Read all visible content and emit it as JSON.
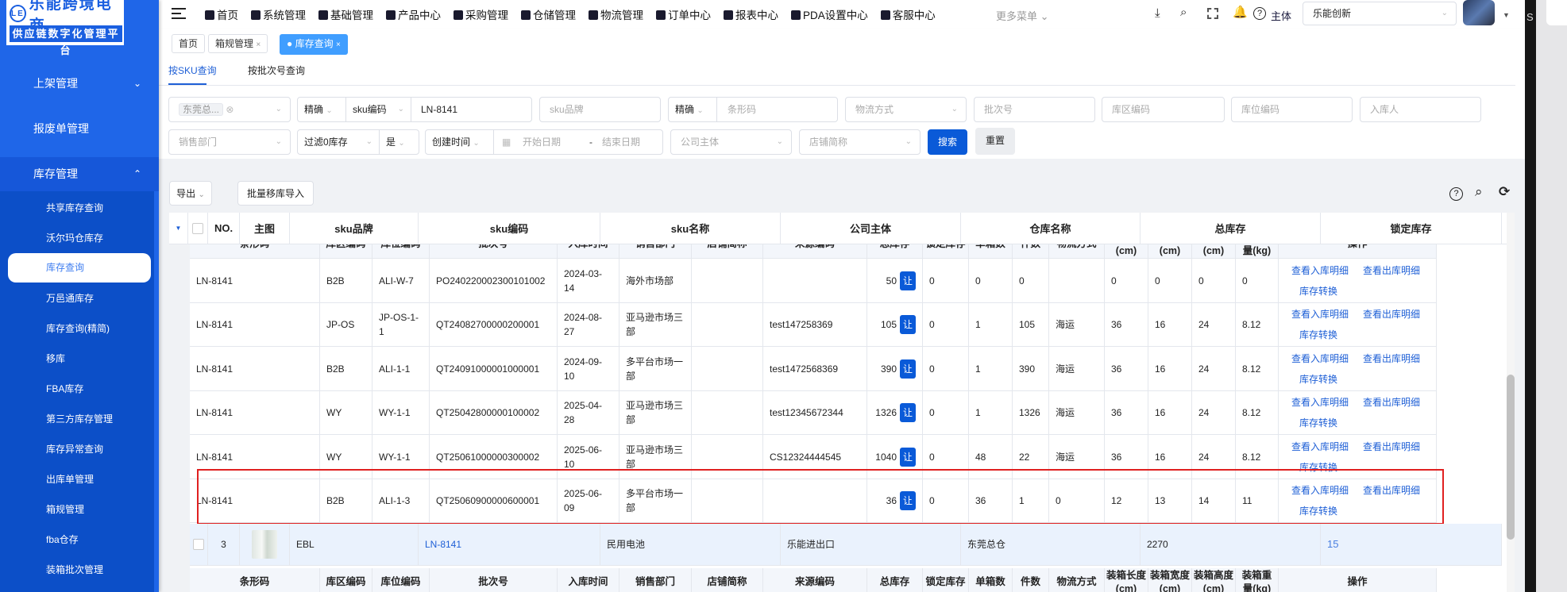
{
  "logo": {
    "title": "乐能跨境电商",
    "subtitle": "供应链数字化管理平台",
    "mark": "LE"
  },
  "sidebar": {
    "groups": [
      {
        "label": "上架管理",
        "chev": "⌄"
      },
      {
        "label": "报废单管理"
      },
      {
        "label": "库存管理",
        "chev": "⌃"
      }
    ],
    "sub_items": [
      "共享库存查询",
      "沃尔玛仓库存",
      "库存查询",
      "万邑通库存",
      "库存查询(精简)",
      "移库",
      "FBA库存",
      "第三方库存管理",
      "库存异常查询",
      "出库单管理",
      "箱规管理",
      "fba仓存",
      "装箱批次管理"
    ],
    "active_index": 2
  },
  "topnav": {
    "items": [
      "首页",
      "系统管理",
      "基础管理",
      "产品中心",
      "采购管理",
      "仓储管理",
      "物流管理",
      "订单中心",
      "报表中心",
      "PDA设置中心",
      "客服中心"
    ],
    "more": "更多菜单",
    "entity_label": "主体",
    "entity_value": "乐能创新"
  },
  "tabs": [
    {
      "label": "首页"
    },
    {
      "label": "箱规管理",
      "close": "×"
    },
    {
      "label": "库存查询",
      "close": "×"
    }
  ],
  "query_tabs": [
    "按SKU查询",
    "按批次号查询"
  ],
  "filters": {
    "warehouse_tag": "东莞总...",
    "match1": "精确",
    "field1": "sku编码",
    "value1": "LN-8141",
    "sku_brand": "sku品牌",
    "match2": "精确",
    "barcode": "条形码",
    "shipping": "物流方式",
    "batch": "批次号",
    "zone": "库区编码",
    "location": "库位编码",
    "inbound_user": "入库人",
    "dept": "销售部门",
    "filter_zero": "过滤0库存",
    "filter_zero_val": "是",
    "time_type": "创建时间",
    "start_date": "开始日期",
    "date_sep": "-",
    "end_date": "结束日期",
    "company": "公司主体",
    "shop": "店铺简称",
    "search": "搜索",
    "reset": "重置"
  },
  "toolbar": {
    "export": "导出",
    "batch_import": "批量移库导入"
  },
  "table": {
    "header": [
      "",
      "",
      "NO.",
      "主图",
      "sku品牌",
      "sku编码",
      "sku名称",
      "公司主体",
      "仓库名称",
      "总库存",
      "锁定库存"
    ],
    "sub_header": [
      "条形码",
      "库区编码",
      "库位编码",
      "批次号",
      "入库时间",
      "销售部门",
      "店铺简称",
      "来源编码",
      "总库存",
      "锁定库存",
      "单箱数",
      "件数",
      "物流方式",
      "装箱长度(cm)",
      "装箱宽度(cm)",
      "装箱高度(cm)",
      "装箱重量(kg)",
      "操作"
    ],
    "transfer_btn": "让",
    "actions": [
      "查看入库明细",
      "查看出库明细",
      "库存转换"
    ],
    "rows": [
      [
        "LN-8141",
        "B2B",
        "ALI-W-7",
        "PO240220002300101002",
        "2024-03-14",
        "海外市场部",
        "",
        "",
        "50",
        "0",
        "0",
        "0",
        "",
        "0",
        "0",
        "0",
        "0"
      ],
      [
        "LN-8141",
        "JP-OS",
        "JP-OS-1-1",
        "QT24082700000200001",
        "2024-08-27",
        "亚马逊市场三部",
        "",
        "test147258369",
        "105",
        "0",
        "1",
        "105",
        "海运",
        "36",
        "16",
        "24",
        "8.12"
      ],
      [
        "LN-8141",
        "B2B",
        "ALI-1-1",
        "QT24091000001000001",
        "2024-09-10",
        "多平台市场一部",
        "",
        "test1472568369",
        "390",
        "0",
        "1",
        "390",
        "海运",
        "36",
        "16",
        "24",
        "8.12"
      ],
      [
        "LN-8141",
        "WY",
        "WY-1-1",
        "QT25042800000100002",
        "2025-04-28",
        "亚马逊市场三部",
        "",
        "test12345672344",
        "1326",
        "0",
        "1",
        "1326",
        "海运",
        "36",
        "16",
        "24",
        "8.12"
      ],
      [
        "LN-8141",
        "WY",
        "WY-1-1",
        "QT25061000000300002",
        "2025-06-10",
        "亚马逊市场三部",
        "",
        "CS12324444545",
        "1040",
        "0",
        "48",
        "22",
        "海运",
        "36",
        "16",
        "24",
        "8.12"
      ],
      [
        "LN-8141",
        "B2B",
        "ALI-1-3",
        "QT25060900000600001",
        "2025-06-09",
        "多平台市场一部",
        "",
        "",
        "36",
        "0",
        "36",
        "1",
        "0",
        "12",
        "13",
        "14",
        "11"
      ]
    ],
    "highlighted_row": 5,
    "parent_row": {
      "no": "3",
      "brand": "EBL",
      "sku": "LN-8141",
      "name": "民用电池",
      "company": "乐能进出口",
      "warehouse": "东莞总仓",
      "total": "2270",
      "locked": "15"
    }
  },
  "edge_letter": "S",
  "colors": {
    "sidebar": "#1f66e8",
    "submenu": "#0c4fc8",
    "accent": "#0a5ad8",
    "link": "#1e5fd6",
    "highlight_border": "#e02020"
  }
}
